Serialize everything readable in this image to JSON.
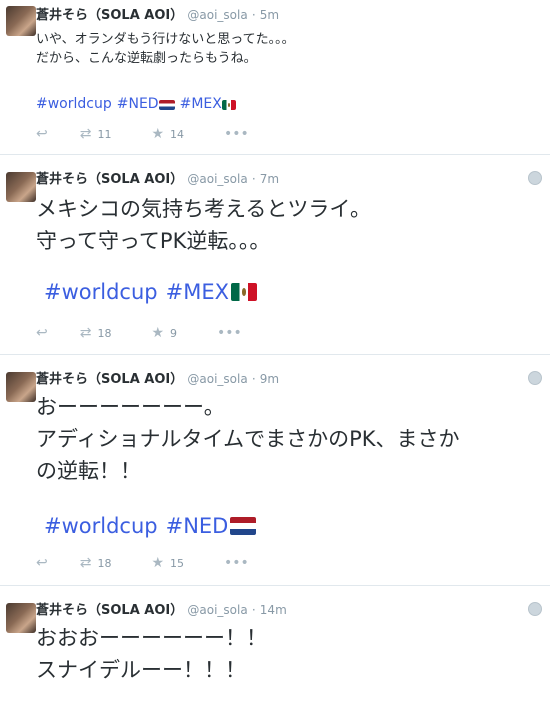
{
  "tweets": [
    {
      "name": "蒼井そら（SOLA AOI）",
      "handle": "@aoi_sola",
      "separator": "·",
      "time": "5m",
      "text": "いや、オランダもう行けないと思ってた。。。\nだから、こんな逆転劇ったらもうね。",
      "hashtags": [
        "#worldcup",
        "#NED",
        "#MEX"
      ],
      "retweets": "11",
      "favorites": "14",
      "more": "•••"
    },
    {
      "name": "蒼井そら（SOLA AOI）",
      "handle": "@aoi_sola",
      "separator": "·",
      "time": "7m",
      "text": "メキシコの気持ち考えるとツライ。\n守って守ってPK逆転。。。",
      "hashtags": [
        "#worldcup",
        "#MEX"
      ],
      "retweets": "18",
      "favorites": "9",
      "more": "•••"
    },
    {
      "name": "蒼井そら（SOLA AOI）",
      "handle": "@aoi_sola",
      "separator": "·",
      "time": "9m",
      "text": "おーーーーーーー。\nアディショナルタイムでまさかのPK、まさか\nの逆転！！",
      "hashtags": [
        "#worldcup",
        "#NED"
      ],
      "retweets": "18",
      "favorites": "15",
      "more": "•••"
    },
    {
      "name": "蒼井そら（SOLA AOI）",
      "handle": "@aoi_sola",
      "separator": "·",
      "time": "14m",
      "text": "おおおーーーーーー！！\nスナイデルーー！！！"
    }
  ],
  "icons": {
    "reply": "reply-icon",
    "retweet": "retweet-icon",
    "favorite": "star-icon",
    "more": "more-icon",
    "globe": "globe-icon"
  },
  "colors": {
    "hashtag": "#3b5ee0",
    "muted": "#8899a6",
    "divider": "#e1e8ed"
  }
}
